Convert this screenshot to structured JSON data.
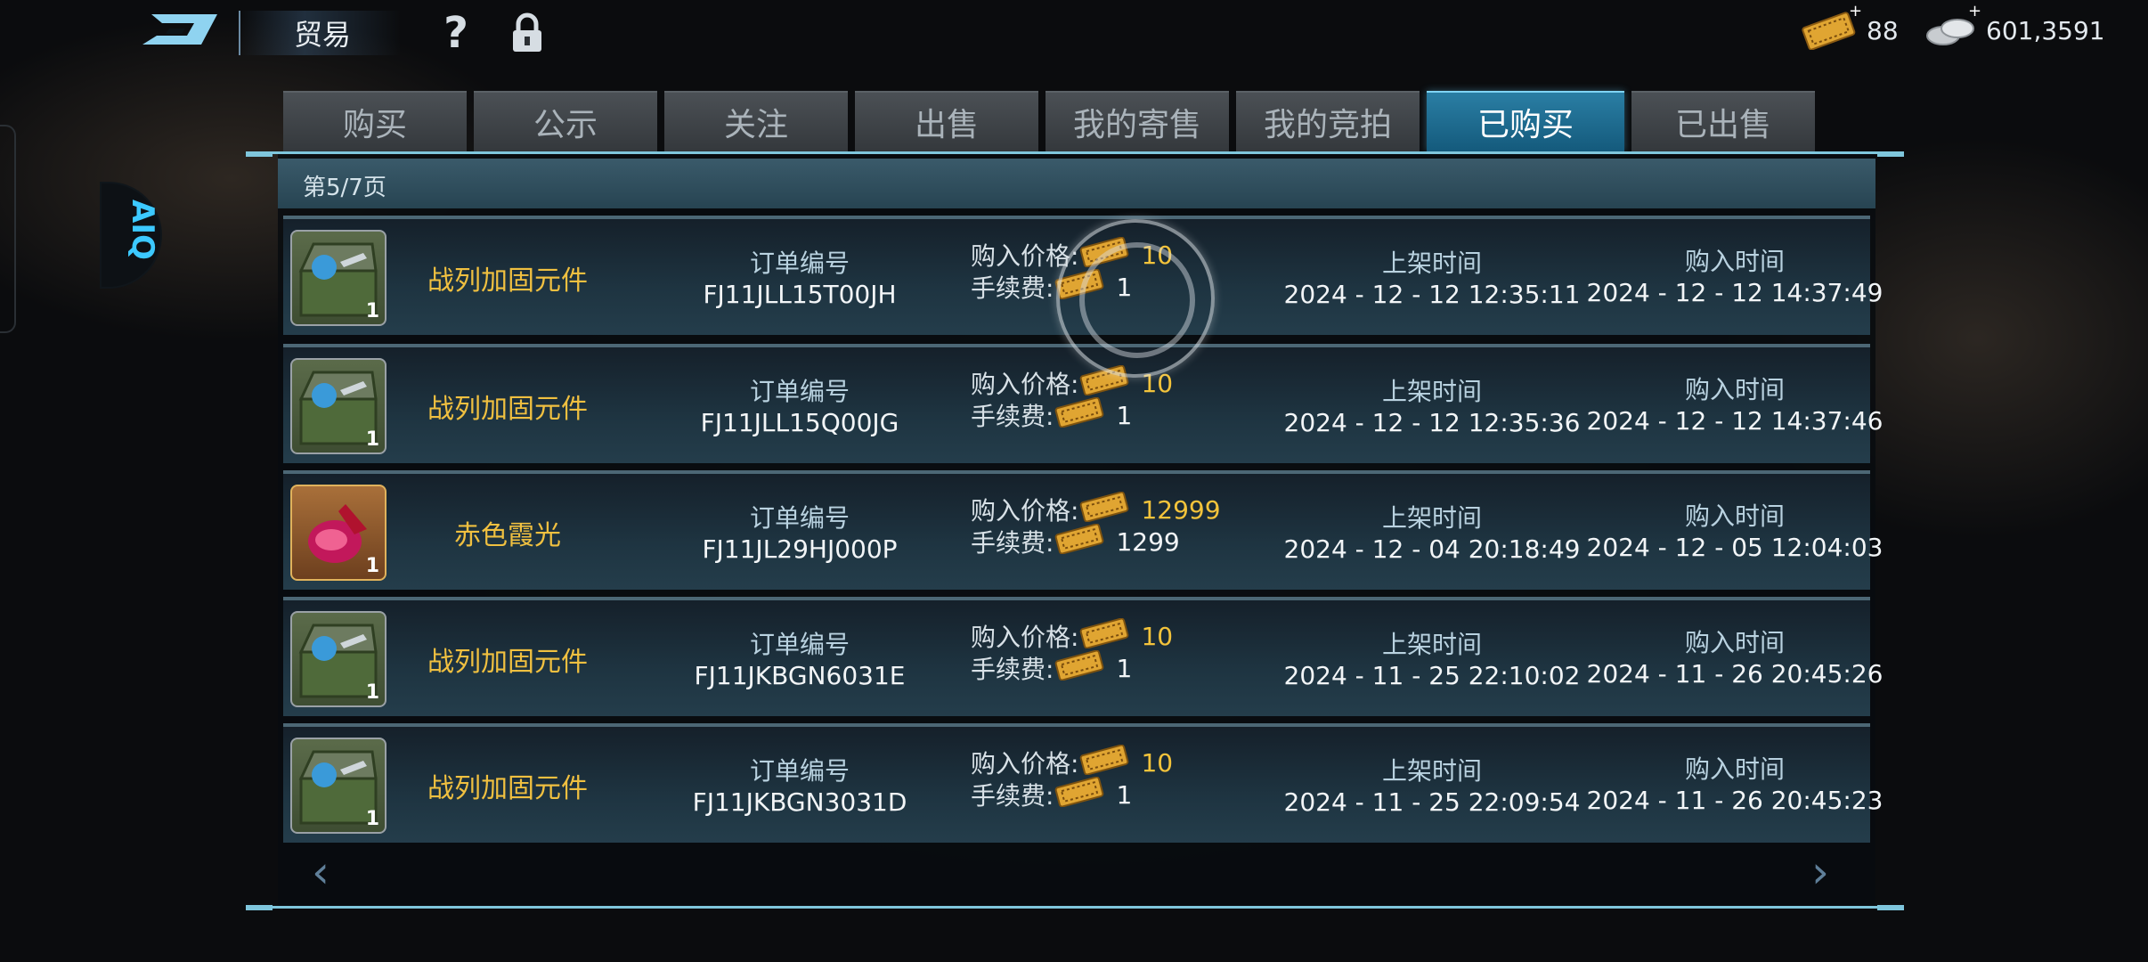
{
  "header": {
    "title": "贸易",
    "currency_ticket": "88",
    "currency_silver": "601,3591",
    "plus": "+"
  },
  "tabs": [
    {
      "label": "购买"
    },
    {
      "label": "公示"
    },
    {
      "label": "关注"
    },
    {
      "label": "出售"
    },
    {
      "label": "我的寄售"
    },
    {
      "label": "我的竞拍"
    },
    {
      "label": "已购买",
      "active": true
    },
    {
      "label": "已出售"
    }
  ],
  "page_indicator": "第5/7页",
  "labels": {
    "order_no": "订单编号",
    "price": "购入价格:",
    "fee": "手续费:",
    "listed_time": "上架时间",
    "bought_time": "购入时间"
  },
  "orders": [
    {
      "name": "战列加固元件",
      "qty": "1",
      "order_no": "FJ11JLL15T00JH",
      "price": "10",
      "fee": "1",
      "listed": "2024 - 12 - 12 12:35:11",
      "bought": "2024 - 12 - 12 14:37:49",
      "icon": "supply-box-icon"
    },
    {
      "name": "战列加固元件",
      "qty": "1",
      "order_no": "FJ11JLL15Q00JG",
      "price": "10",
      "fee": "1",
      "listed": "2024 - 12 - 12 12:35:36",
      "bought": "2024 - 12 - 12 14:37:46",
      "icon": "supply-box-icon"
    },
    {
      "name": "赤色霞光",
      "qty": "1",
      "order_no": "FJ11JL29HJ000P",
      "price": "12999",
      "fee": "1299",
      "listed": "2024 - 12 - 04 20:18:49",
      "bought": "2024 - 12 - 05 12:04:03",
      "icon": "red-gem-icon"
    },
    {
      "name": "战列加固元件",
      "qty": "1",
      "order_no": "FJ11JKBGN6031E",
      "price": "10",
      "fee": "1",
      "listed": "2024 - 11 - 25 22:10:02",
      "bought": "2024 - 11 - 26 20:45:26",
      "icon": "supply-box-icon"
    },
    {
      "name": "战列加固元件",
      "qty": "1",
      "order_no": "FJ11JKBGN3031D",
      "price": "10",
      "fee": "1",
      "listed": "2024 - 11 - 25 22:09:54",
      "bought": "2024 - 11 - 26 20:45:23",
      "icon": "supply-box-icon"
    }
  ],
  "nav": {
    "prev": "‹",
    "next": "›"
  },
  "side_badge": "AIQ",
  "colors": {
    "accent": "#1f6f96",
    "price": "#f3c33b",
    "item_name": "#f0c040"
  }
}
